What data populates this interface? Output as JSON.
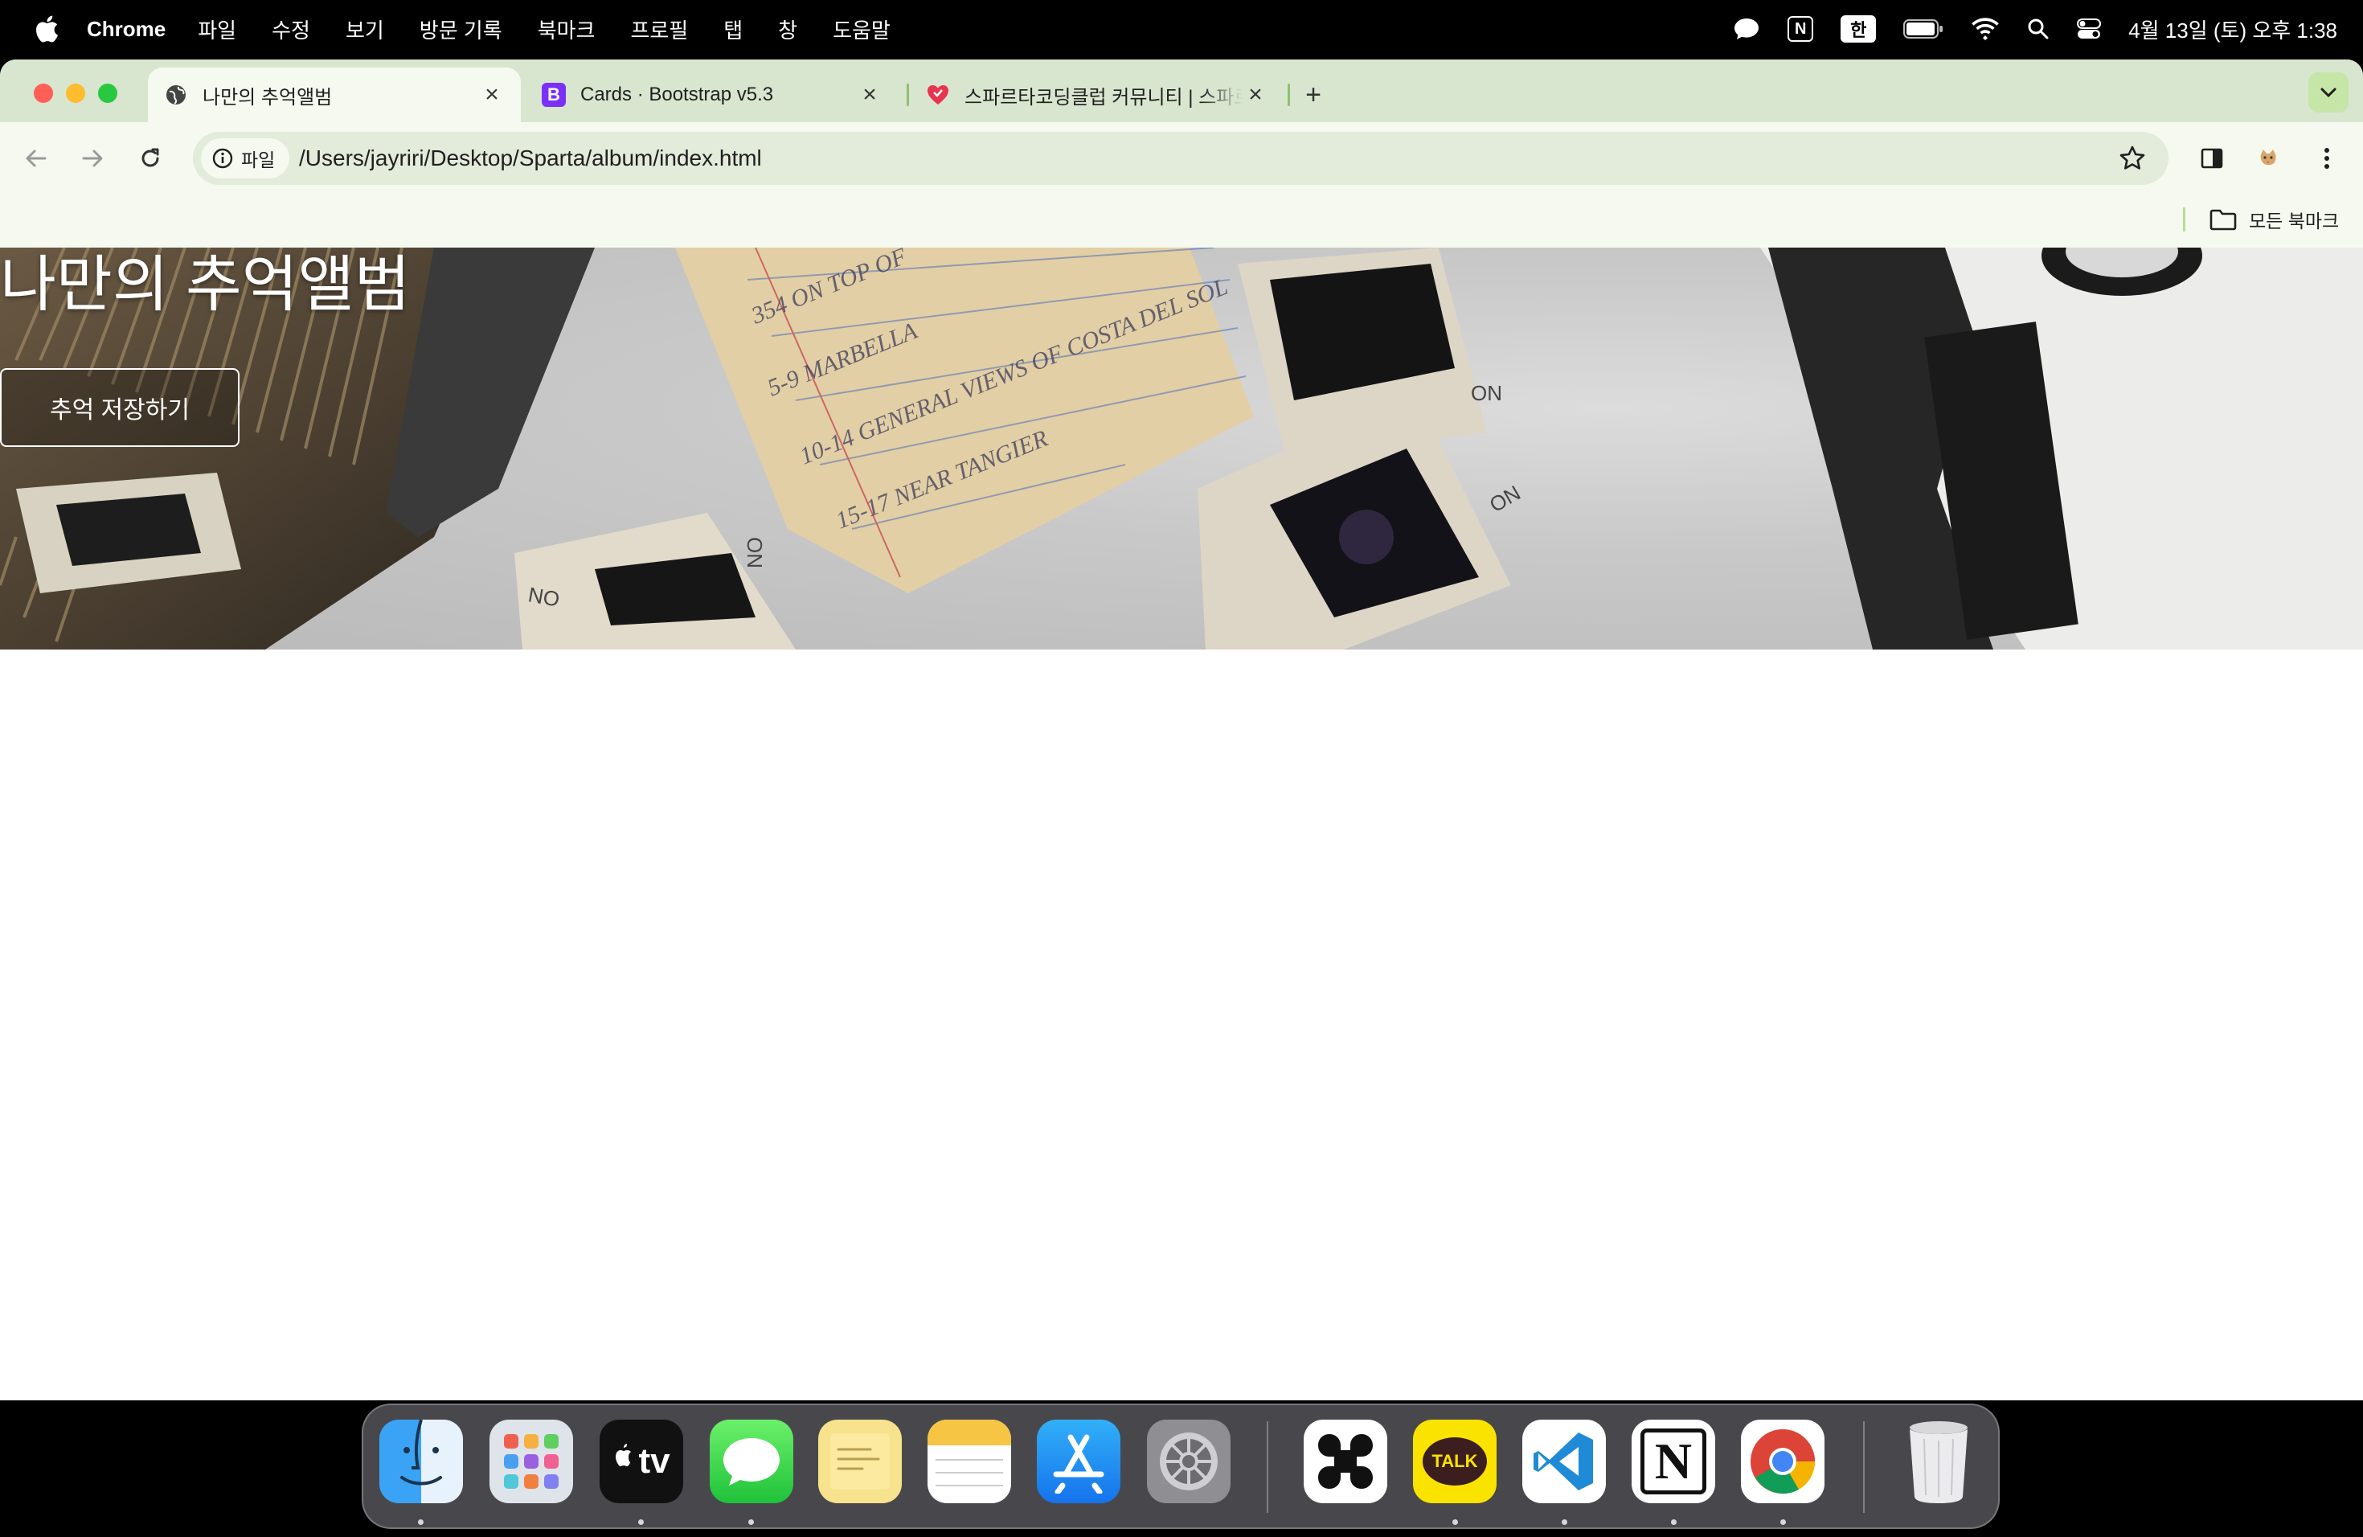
{
  "menubar": {
    "app_name": "Chrome",
    "menus": [
      "파일",
      "수정",
      "보기",
      "방문 기록",
      "북마크",
      "프로필",
      "탭",
      "창",
      "도움말"
    ],
    "status_icons": [
      "chat-bubble-icon",
      "notion-icon",
      "input-source-icon",
      "battery-icon",
      "wifi-icon",
      "spotlight-search-icon",
      "control-center-icon"
    ],
    "notion_glyph": "N",
    "input_source": "한",
    "clock": "4월 13일 (토) 오후 1:38"
  },
  "tabs": [
    {
      "title": "나만의 추억앨범",
      "favicon": "globe-icon",
      "active": true
    },
    {
      "title": "Cards · Bootstrap v5.3",
      "favicon": "bootstrap-icon",
      "favicon_glyph": "B",
      "active": false
    },
    {
      "title": "스파르타코딩클럽 커뮤니티 | 스파르",
      "favicon": "sparta-heart-icon",
      "active": false
    }
  ],
  "toolbar": {
    "site_chip_label": "파일",
    "url": "/Users/jayriri/Desktop/Sparta/album/index.html"
  },
  "bookmarks_bar": {
    "all_bookmarks_label": "모든 북마크"
  },
  "page": {
    "hero_title": "나만의 추억앨범",
    "hero_button_label": "추억 저장하기"
  },
  "dock": {
    "apps": [
      {
        "name": "Finder",
        "running": true
      },
      {
        "name": "Launchpad",
        "running": false
      },
      {
        "name": "Apple TV",
        "running": true
      },
      {
        "name": "Messages",
        "running": true
      },
      {
        "name": "Stickies",
        "running": false
      },
      {
        "name": "Notes",
        "running": false
      },
      {
        "name": "App Store",
        "running": false
      },
      {
        "name": "System Settings",
        "running": false
      },
      {
        "name": "Capcut",
        "running": false
      },
      {
        "name": "KakaoTalk",
        "running": true
      },
      {
        "name": "Visual Studio Code",
        "running": true
      },
      {
        "name": "Notion",
        "running": true
      },
      {
        "name": "Google Chrome",
        "running": true
      },
      {
        "name": "Trash",
        "running": false
      }
    ],
    "tv_label": "tv",
    "talk_label": "TALK",
    "notion_label": "N"
  },
  "colors": {
    "tab_strip": "#d8e6cf",
    "toolbar": "#f6f9f0",
    "omnibox": "#e3ebdb",
    "accent_green": "#8fbf6f"
  }
}
